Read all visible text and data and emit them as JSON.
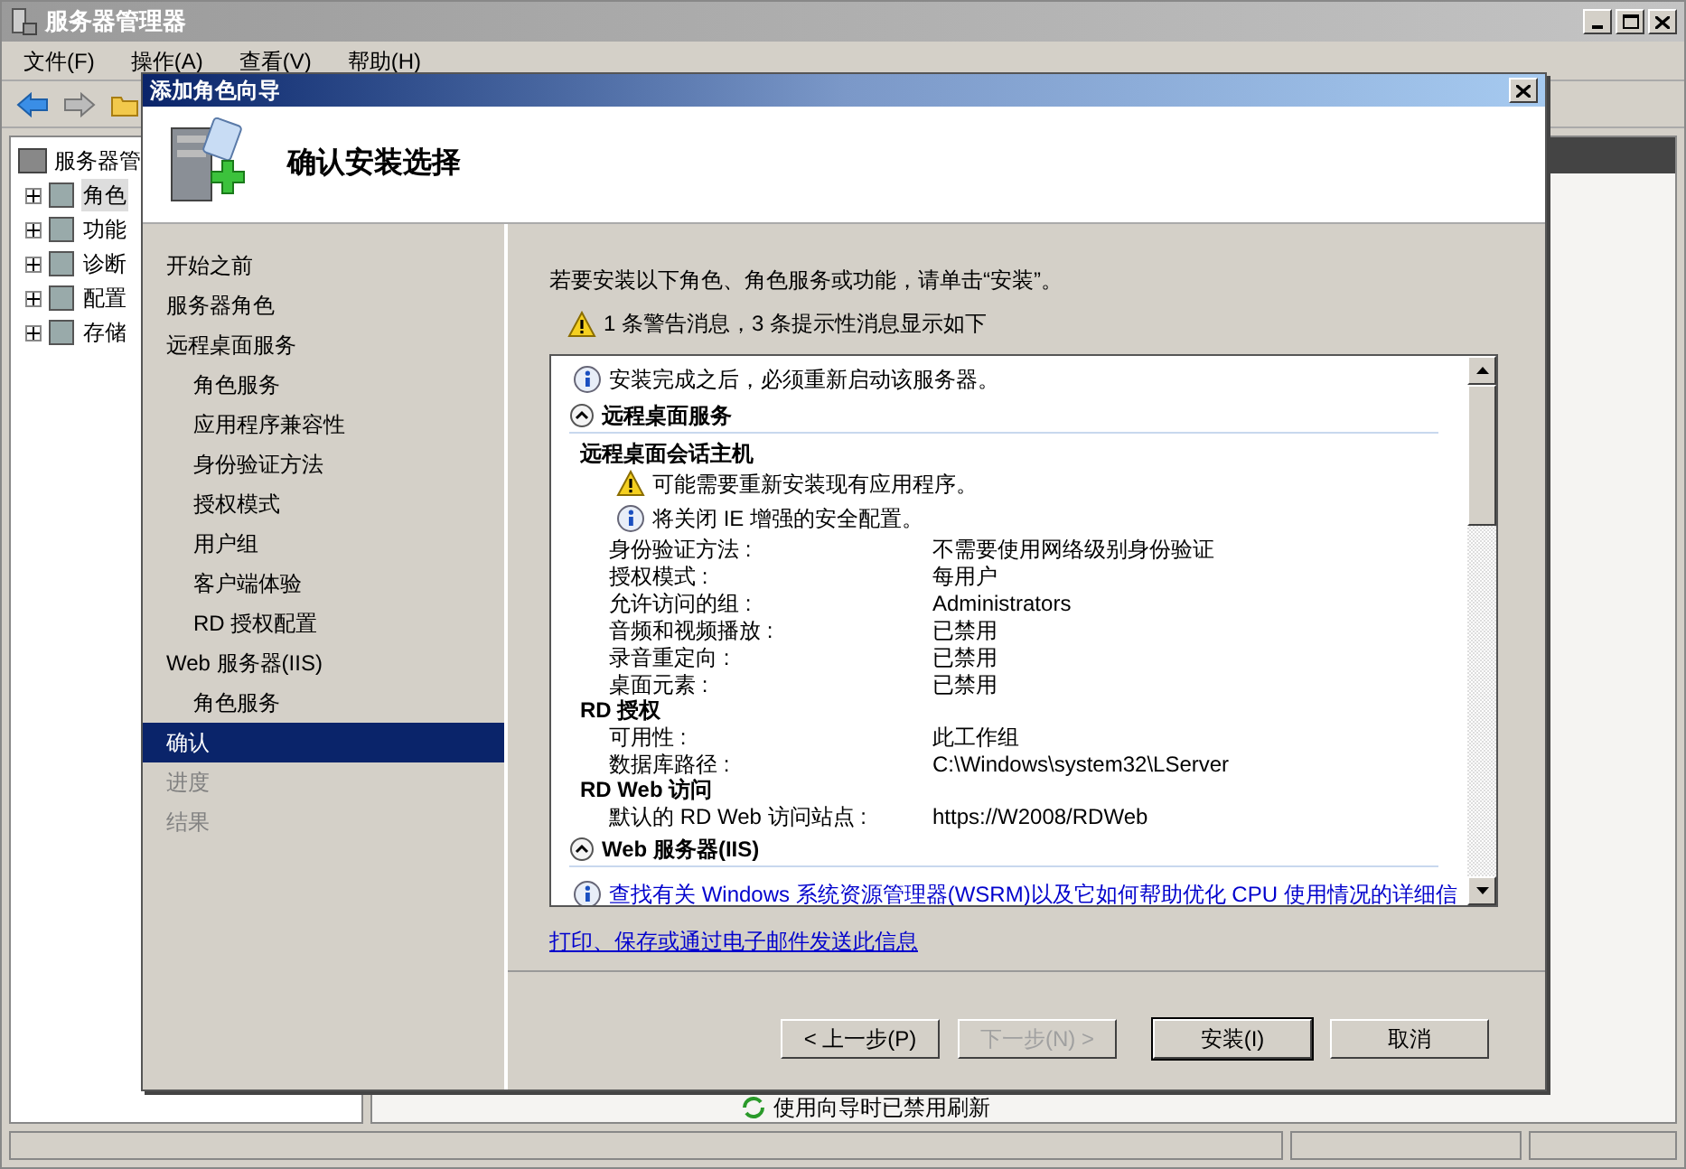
{
  "window": {
    "title": "服务器管理器"
  },
  "menu": [
    "文件(F)",
    "操作(A)",
    "查看(V)",
    "帮助(H)"
  ],
  "tree": {
    "label": "服务器管",
    "children": [
      {
        "label": "角色",
        "selected": true
      },
      {
        "label": "功能",
        "selected": false
      },
      {
        "label": "诊断",
        "selected": false
      },
      {
        "label": "配置",
        "selected": false
      },
      {
        "label": "存储",
        "selected": false
      }
    ]
  },
  "status_text": "使用向导时已禁用刷新",
  "dialog": {
    "title": "添加角色向导",
    "heading": "确认安装选择",
    "steps": [
      {
        "label": "开始之前",
        "selected": false,
        "disabled": false
      },
      {
        "label": "服务器角色",
        "selected": false,
        "disabled": false
      },
      {
        "label": "远程桌面服务",
        "selected": false,
        "disabled": false,
        "children": [
          {
            "label": "角色服务",
            "selected": false,
            "disabled": false
          },
          {
            "label": "应用程序兼容性",
            "selected": false,
            "disabled": false
          },
          {
            "label": "身份验证方法",
            "selected": false,
            "disabled": false
          },
          {
            "label": "授权模式",
            "selected": false,
            "disabled": false
          },
          {
            "label": "用户组",
            "selected": false,
            "disabled": false
          },
          {
            "label": "客户端体验",
            "selected": false,
            "disabled": false
          },
          {
            "label": "RD 授权配置",
            "selected": false,
            "disabled": false
          }
        ]
      },
      {
        "label": "Web 服务器(IIS)",
        "selected": false,
        "disabled": false,
        "children": [
          {
            "label": "角色服务",
            "selected": false,
            "disabled": false
          }
        ]
      },
      {
        "label": "确认",
        "selected": true,
        "disabled": false
      },
      {
        "label": "进度",
        "selected": false,
        "disabled": true
      },
      {
        "label": "结果",
        "selected": false,
        "disabled": true
      }
    ],
    "intro": "若要安装以下角色、角色服务或功能，请单击“安装”。",
    "summary": "1 条警告消息，3 条提示性消息显示如下",
    "details": [
      {
        "kind": "info",
        "text": "安装完成之后，必须重新启动该服务器。"
      },
      {
        "kind": "section",
        "title": "远程桌面服务",
        "expanded": true
      },
      {
        "kind": "subheading",
        "text": "远程桌面会话主机",
        "notes": [
          {
            "kind": "warning",
            "text": "可能需要重新安装现有应用程序。"
          },
          {
            "kind": "info",
            "text": "将关闭 IE 增强的安全配置。"
          }
        ]
      },
      {
        "kind": "property",
        "label": "身份验证方法 :",
        "value": "不需要使用网络级别身份验证"
      },
      {
        "kind": "property",
        "label": "授权模式 :",
        "value": "每用户"
      },
      {
        "kind": "property",
        "label": "允许访问的组 :",
        "value": "Administrators"
      },
      {
        "kind": "property",
        "label": "音频和视频播放 :",
        "value": "已禁用"
      },
      {
        "kind": "property",
        "label": "录音重定向 :",
        "value": "已禁用"
      },
      {
        "kind": "property",
        "label": "桌面元素 :",
        "value": "已禁用"
      },
      {
        "kind": "subheading",
        "text": "RD 授权"
      },
      {
        "kind": "property",
        "label": "可用性 :",
        "value": "此工作组"
      },
      {
        "kind": "property",
        "label": "数据库路径 :",
        "value": "C:\\Windows\\system32\\LServer"
      },
      {
        "kind": "subheading",
        "text": "RD Web 访问"
      },
      {
        "kind": "property",
        "label": "默认的 RD Web 访问站点 :",
        "value": "https://W2008/RDWeb"
      },
      {
        "kind": "section",
        "title": "Web 服务器(IIS)",
        "expanded": true
      },
      {
        "kind": "link",
        "text": "查找有关 Windows 系统资源管理器(WSRM)以及它如何帮助优化 CPU 使用情况的详细信"
      }
    ],
    "link": "打印、保存或通过电子邮件发送此信息",
    "buttons": [
      {
        "label": "< 上一步(P)",
        "disabled": false,
        "default": false
      },
      {
        "label": "下一步(N) >",
        "disabled": true,
        "default": false
      },
      {
        "label": "安装(I)",
        "disabled": false,
        "default": true
      },
      {
        "label": "取消",
        "disabled": false,
        "default": false
      }
    ]
  }
}
